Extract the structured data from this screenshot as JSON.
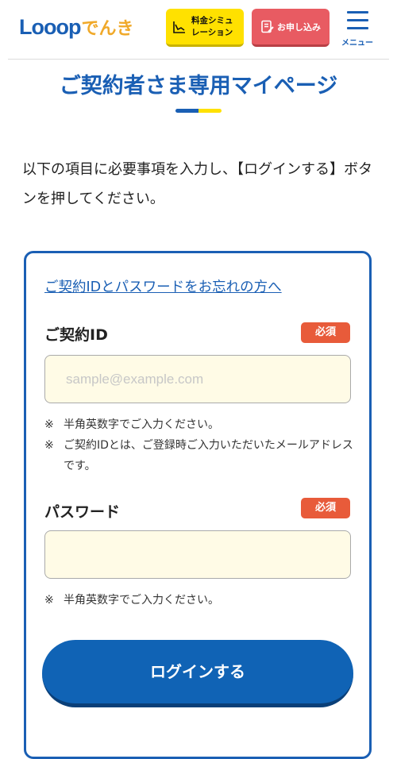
{
  "header": {
    "logo_en": "Looop",
    "logo_jp": "でんき",
    "simulation_label": "料金シミュ\nレーション",
    "simulation_icon": "chart-line-icon",
    "apply_label": "お申し込み",
    "apply_icon": "form-pen-icon",
    "menu_label": "メニュー",
    "menu_icon": "hamburger-icon"
  },
  "page": {
    "title": "ご契約者さま専用マイページ",
    "intro": "以下の項目に必要事項を入力し、【ログインする】ボタンを押してください。"
  },
  "form": {
    "forgot_link": "ご契約IDとパスワードをお忘れの方へ",
    "id_label": "ご契約ID",
    "id_required": "必須",
    "id_placeholder": "sample@example.com",
    "id_value": "",
    "id_note_1_mark": "※",
    "id_note_1": "半角英数字でご入力ください。",
    "id_note_2_mark": "※",
    "id_note_2": "ご契約IDとは、ご登録時ご入力いただいたメールアドレスです。",
    "password_label": "パスワード",
    "password_required": "必須",
    "password_value": "",
    "password_note_mark": "※",
    "password_note": "半角英数字でご入力ください。",
    "login_button": "ログインする"
  },
  "colors": {
    "brand_blue": "#1a5fb4",
    "accent_yellow": "#ffe100",
    "apply_red": "#e85b62",
    "required_orange": "#e85b3a",
    "input_bg": "#fffbe6"
  }
}
